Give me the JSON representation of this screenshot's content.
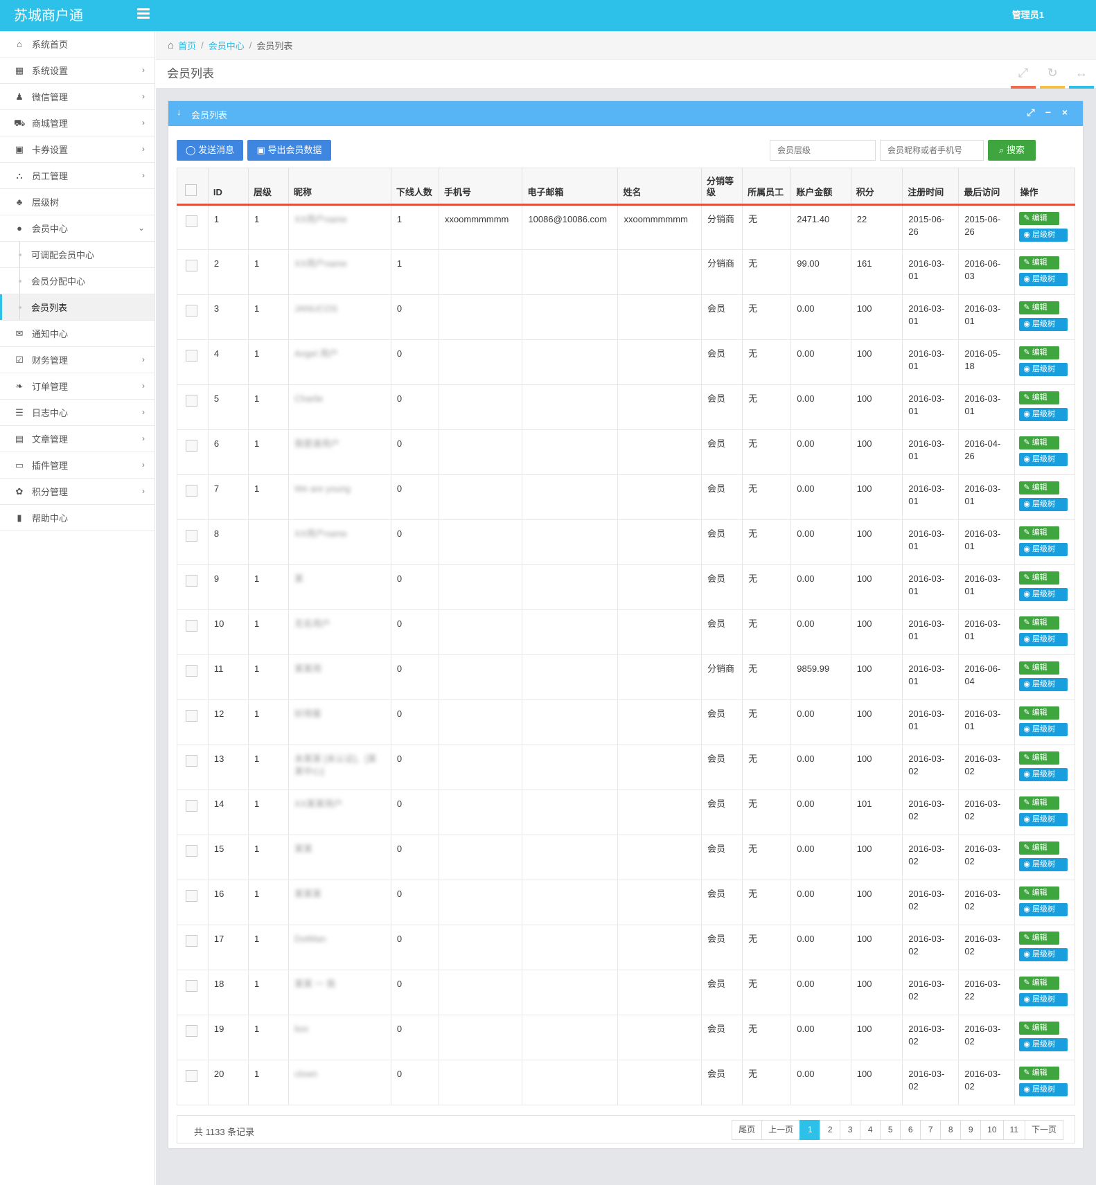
{
  "app": {
    "brand": "苏城商户通",
    "user": "管理员1"
  },
  "sidebar": {
    "items": [
      {
        "label": "系统首页",
        "icon": "home-icon",
        "glyph": "⌂",
        "arrow": false
      },
      {
        "label": "系统设置",
        "icon": "grid-icon",
        "glyph": "▦",
        "arrow": true
      },
      {
        "label": "微信管理",
        "icon": "wechat-icon",
        "glyph": "♟",
        "arrow": true
      },
      {
        "label": "商城管理",
        "icon": "cart-icon",
        "glyph": "⛟",
        "arrow": true
      },
      {
        "label": "卡券设置",
        "icon": "ticket-icon",
        "glyph": "▣",
        "arrow": true
      },
      {
        "label": "员工管理",
        "icon": "sitemap-icon",
        "glyph": "⛬",
        "arrow": true
      },
      {
        "label": "层级树",
        "icon": "tree-icon",
        "glyph": "♣",
        "arrow": false
      },
      {
        "label": "会员中心",
        "icon": "user-icon",
        "glyph": "●",
        "arrow": true,
        "expanded": true
      }
    ],
    "subitems": [
      {
        "label": "可调配会员中心"
      },
      {
        "label": "会员分配中心"
      },
      {
        "label": "会员列表",
        "active": true
      }
    ],
    "items2": [
      {
        "label": "通知中心",
        "icon": "envelope-icon",
        "glyph": "✉",
        "arrow": false
      },
      {
        "label": "财务管理",
        "icon": "check-square-icon",
        "glyph": "☑",
        "arrow": true
      },
      {
        "label": "订单管理",
        "icon": "leaf-icon",
        "glyph": "❧",
        "arrow": true
      },
      {
        "label": "日志中心",
        "icon": "list-icon",
        "glyph": "☰",
        "arrow": true
      },
      {
        "label": "文章管理",
        "icon": "book-icon",
        "glyph": "▤",
        "arrow": true
      },
      {
        "label": "插件管理",
        "icon": "inbox-icon",
        "glyph": "▭",
        "arrow": true
      },
      {
        "label": "积分管理",
        "icon": "gift-icon",
        "glyph": "✿",
        "arrow": true
      },
      {
        "label": "帮助中心",
        "icon": "help-book-icon",
        "glyph": "▮",
        "arrow": false
      }
    ]
  },
  "breadcrumb": {
    "home": "首页",
    "section": "会员中心",
    "current": "会员列表",
    "sep": "/"
  },
  "page": {
    "title": "会员列表"
  },
  "widget": {
    "title": "会员列表"
  },
  "toolbar": {
    "send_label": "发送消息",
    "export_label": "导出会员数据",
    "level_placeholder": "会员层级",
    "keyword_placeholder": "会员昵称或者手机号",
    "search_label": "搜索"
  },
  "table": {
    "columns": [
      "",
      "ID",
      "层级",
      "昵称",
      "下线人数",
      "手机号",
      "电子邮箱",
      "姓名",
      "分销等级",
      "所属员工",
      "账户金额",
      "积分",
      "注册时间",
      "最后访问",
      "操作"
    ],
    "edit_label": "编辑",
    "tree_label": "层级树",
    "rows": [
      {
        "id": "1",
        "level": "1",
        "nick": "XX用户name",
        "down": "1",
        "phone": "xxoommmmmm",
        "email": "10086@10086.com",
        "name": "xxoommmmmm",
        "grade": "分销商",
        "staff": "无",
        "amount": "2471.40",
        "points": "22",
        "reg": "2015-06-26",
        "last": "2015-06-26"
      },
      {
        "id": "2",
        "level": "1",
        "nick": "XX用户name",
        "down": "1",
        "phone": "",
        "email": "",
        "name": "",
        "grade": "分销商",
        "staff": "无",
        "amount": "99.00",
        "points": "161",
        "reg": "2016-03-01",
        "last": "2016-06-03"
      },
      {
        "id": "3",
        "level": "1",
        "nick": "JANUCOS",
        "down": "0",
        "phone": "",
        "email": "",
        "name": "",
        "grade": "会员",
        "staff": "无",
        "amount": "0.00",
        "points": "100",
        "reg": "2016-03-01",
        "last": "2016-03-01"
      },
      {
        "id": "4",
        "level": "1",
        "nick": "Angel 用户",
        "down": "0",
        "phone": "",
        "email": "",
        "name": "",
        "grade": "会员",
        "staff": "无",
        "amount": "0.00",
        "points": "100",
        "reg": "2016-03-01",
        "last": "2016-05-18"
      },
      {
        "id": "5",
        "level": "1",
        "nick": "Charlie",
        "down": "0",
        "phone": "",
        "email": "",
        "name": "",
        "grade": "会员",
        "staff": "无",
        "amount": "0.00",
        "points": "100",
        "reg": "2016-03-01",
        "last": "2016-03-01"
      },
      {
        "id": "6",
        "level": "1",
        "nick": "我是谁用户",
        "down": "0",
        "phone": "",
        "email": "",
        "name": "",
        "grade": "会员",
        "staff": "无",
        "amount": "0.00",
        "points": "100",
        "reg": "2016-03-01",
        "last": "2016-04-26"
      },
      {
        "id": "7",
        "level": "1",
        "nick": "We are young",
        "down": "0",
        "phone": "",
        "email": "",
        "name": "",
        "grade": "会员",
        "staff": "无",
        "amount": "0.00",
        "points": "100",
        "reg": "2016-03-01",
        "last": "2016-03-01"
      },
      {
        "id": "8",
        "level": "",
        "nick": "XX用户name",
        "down": "0",
        "phone": "",
        "email": "",
        "name": "",
        "grade": "会员",
        "staff": "无",
        "amount": "0.00",
        "points": "100",
        "reg": "2016-03-01",
        "last": "2016-03-01"
      },
      {
        "id": "9",
        "level": "1",
        "nick": "某",
        "down": "0",
        "phone": "",
        "email": "",
        "name": "",
        "grade": "会员",
        "staff": "无",
        "amount": "0.00",
        "points": "100",
        "reg": "2016-03-01",
        "last": "2016-03-01"
      },
      {
        "id": "10",
        "level": "1",
        "nick": "无名用户",
        "down": "0",
        "phone": "",
        "email": "",
        "name": "",
        "grade": "会员",
        "staff": "无",
        "amount": "0.00",
        "points": "100",
        "reg": "2016-03-01",
        "last": "2016-03-01"
      },
      {
        "id": "11",
        "level": "1",
        "nick": "某某用",
        "down": "0",
        "phone": "",
        "email": "",
        "name": "",
        "grade": "分销商",
        "staff": "无",
        "amount": "9859.99",
        "points": "100",
        "reg": "2016-03-01",
        "last": "2016-06-04"
      },
      {
        "id": "12",
        "level": "1",
        "nick": "好用客",
        "down": "0",
        "phone": "",
        "email": "",
        "name": "",
        "grade": "会员",
        "staff": "无",
        "amount": "0.00",
        "points": "100",
        "reg": "2016-03-01",
        "last": "2016-03-01"
      },
      {
        "id": "13",
        "level": "1",
        "nick": "未某某 [未认证]、[某某中心]",
        "down": "0",
        "phone": "",
        "email": "",
        "name": "",
        "grade": "会员",
        "staff": "无",
        "amount": "0.00",
        "points": "100",
        "reg": "2016-03-02",
        "last": "2016-03-02"
      },
      {
        "id": "14",
        "level": "1",
        "nick": "XX某某用户",
        "down": "0",
        "phone": "",
        "email": "",
        "name": "",
        "grade": "会员",
        "staff": "无",
        "amount": "0.00",
        "points": "101",
        "reg": "2016-03-02",
        "last": "2016-03-02"
      },
      {
        "id": "15",
        "level": "1",
        "nick": "某某",
        "down": "0",
        "phone": "",
        "email": "",
        "name": "",
        "grade": "会员",
        "staff": "无",
        "amount": "0.00",
        "points": "100",
        "reg": "2016-03-02",
        "last": "2016-03-02"
      },
      {
        "id": "16",
        "level": "1",
        "nick": "某某某",
        "down": "0",
        "phone": "",
        "email": "",
        "name": "",
        "grade": "会员",
        "staff": "无",
        "amount": "0.00",
        "points": "100",
        "reg": "2016-03-02",
        "last": "2016-03-02"
      },
      {
        "id": "17",
        "level": "1",
        "nick": "DotMan",
        "down": "0",
        "phone": "",
        "email": "",
        "name": "",
        "grade": "会员",
        "staff": "无",
        "amount": "0.00",
        "points": "100",
        "reg": "2016-03-02",
        "last": "2016-03-02"
      },
      {
        "id": "18",
        "level": "1",
        "nick": "某某 一 我",
        "down": "0",
        "phone": "",
        "email": "",
        "name": "",
        "grade": "会员",
        "staff": "无",
        "amount": "0.00",
        "points": "100",
        "reg": "2016-03-02",
        "last": "2016-03-22"
      },
      {
        "id": "19",
        "level": "1",
        "nick": "lion",
        "down": "0",
        "phone": "",
        "email": "",
        "name": "",
        "grade": "会员",
        "staff": "无",
        "amount": "0.00",
        "points": "100",
        "reg": "2016-03-02",
        "last": "2016-03-02"
      },
      {
        "id": "20",
        "level": "1",
        "nick": "clown",
        "down": "0",
        "phone": "",
        "email": "",
        "name": "",
        "grade": "会员",
        "staff": "无",
        "amount": "0.00",
        "points": "100",
        "reg": "2016-03-02",
        "last": "2016-03-02"
      }
    ]
  },
  "pagination": {
    "total_text": "共 1133 条记录",
    "first": "尾页",
    "prev": "上一页",
    "pages": [
      "1",
      "2",
      "3",
      "4",
      "5",
      "6",
      "7",
      "8",
      "9",
      "10",
      "11"
    ],
    "current": "1",
    "next": "下一页"
  },
  "colors": {
    "topbar": "#2dc0e8",
    "widget_head": "#57b5f5",
    "primary_btn": "#3f86e0",
    "success_btn": "#3fa53f",
    "info_btn": "#1a9fde",
    "table_head_border": "#e2513c",
    "hdr_bar_1": "#f06a4b",
    "hdr_bar_2": "#f5c144",
    "hdr_bar_3": "#2dc0e8"
  }
}
